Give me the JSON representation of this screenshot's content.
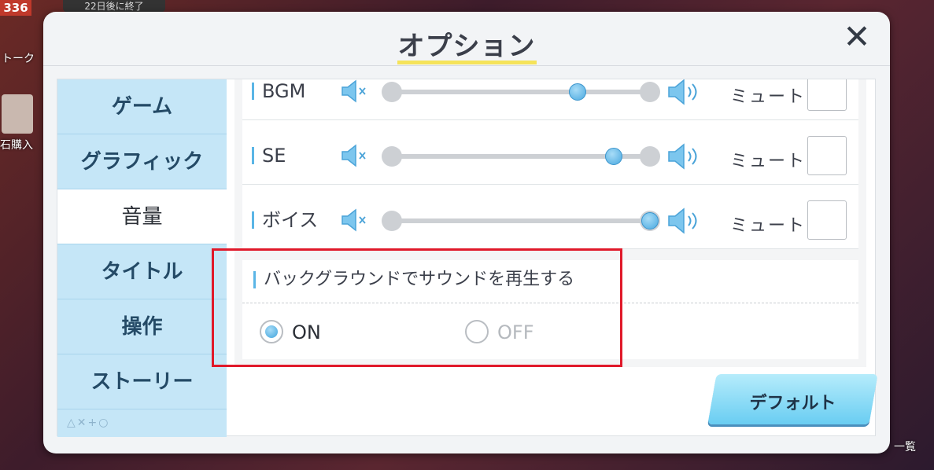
{
  "background": {
    "badge": "336",
    "event_chip": "22日後に終了",
    "left_labels": [
      "トーク",
      "石購入"
    ],
    "right_label": "一覧"
  },
  "dialog": {
    "title": "オプション",
    "close_symbol": "✕"
  },
  "tabs": [
    {
      "label": "ゲーム",
      "active": false
    },
    {
      "label": "グラフィック",
      "active": false
    },
    {
      "label": "音量",
      "active": true
    },
    {
      "label": "タイトル",
      "active": false
    },
    {
      "label": "操作",
      "active": false
    },
    {
      "label": "ストーリー",
      "active": false
    }
  ],
  "tab_glyphs": "△✕+○",
  "volume": {
    "rows": [
      {
        "label": "BGM",
        "level": 0.72,
        "mute_label": "ミュート",
        "muted": false
      },
      {
        "label": "SE",
        "level": 0.86,
        "mute_label": "ミュート",
        "muted": false
      },
      {
        "label": "ボイス",
        "level": 1.0,
        "mute_label": "ミュート",
        "muted": false
      }
    ]
  },
  "background_play": {
    "title": "バックグラウンドでサウンドを再生する",
    "options": [
      {
        "label": "ON",
        "selected": true
      },
      {
        "label": "OFF",
        "selected": false
      }
    ]
  },
  "default_button": {
    "label": "デフォルト"
  },
  "colors": {
    "accent_blue": "#5ab5e6",
    "tab_background": "#c5e6f7",
    "highlight_red": "#e0192a",
    "title_underline": "#f5e35a"
  }
}
